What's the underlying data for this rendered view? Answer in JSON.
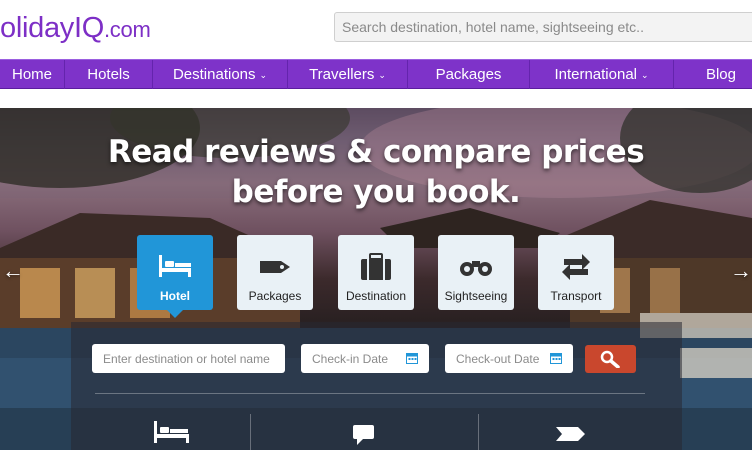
{
  "header": {
    "logo_main": "olidayIQ",
    "logo_domain": ".com",
    "search_placeholder": "Search destination, hotel name, sightseeing etc.."
  },
  "nav": {
    "items": [
      {
        "label": "Home",
        "dropdown": false
      },
      {
        "label": "Hotels",
        "dropdown": false
      },
      {
        "label": "Destinations",
        "dropdown": true
      },
      {
        "label": "Travellers",
        "dropdown": true
      },
      {
        "label": "Packages",
        "dropdown": false
      },
      {
        "label": "International",
        "dropdown": true
      },
      {
        "label": "Blog",
        "dropdown": false
      }
    ],
    "chevron": "⌄"
  },
  "hero": {
    "headline_line1": "Read reviews & compare prices",
    "headline_line2": "before you book.",
    "prev_arrow": "←",
    "next_arrow": "→"
  },
  "search_tabs": [
    {
      "label": "Hotel",
      "icon": "bed-icon",
      "active": true
    },
    {
      "label": "Packages",
      "icon": "tag-icon",
      "active": false
    },
    {
      "label": "Destination",
      "icon": "suitcase-icon",
      "active": false
    },
    {
      "label": "Sightseeing",
      "icon": "binoculars-icon",
      "active": false
    },
    {
      "label": "Transport",
      "icon": "swap-arrows-icon",
      "active": false
    }
  ],
  "search_form": {
    "destination_placeholder": "Enter destination or hotel name",
    "checkin_placeholder": "Check-in Date",
    "checkout_placeholder": "Check-out Date",
    "submit_icon": "magnifier-icon"
  },
  "bottom_icons": [
    "bed-icon",
    "speech-bubble-icon",
    "tag-icon"
  ],
  "colors": {
    "brand_purple": "#7e33c9",
    "active_tab": "#2196d8",
    "search_button": "#c9472d",
    "calendar": "#2196d8"
  }
}
